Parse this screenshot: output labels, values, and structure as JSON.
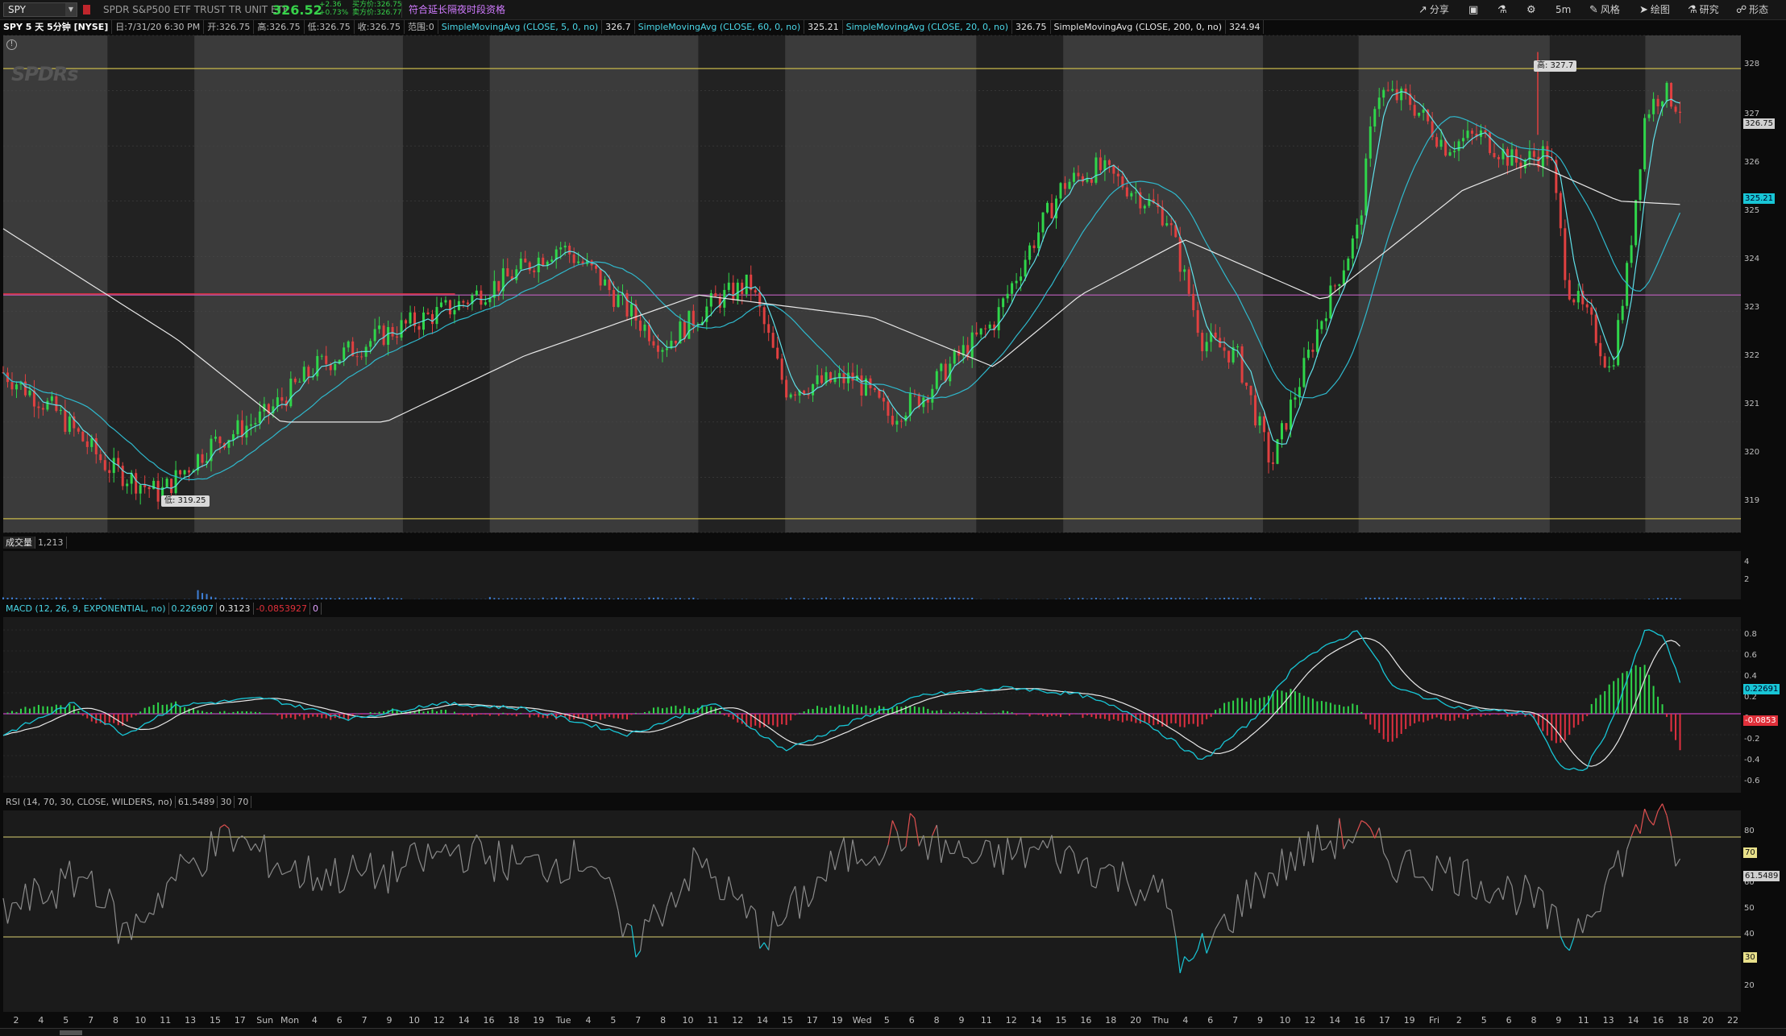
{
  "toolbar": {
    "symbol": "SPY",
    "company": "SPDR S&P500 ETF TRUST TR UNIT ETF",
    "last": "326.52",
    "net_change": "+2.36",
    "pct_change": "+0.73%",
    "bid": "买方价:326.75",
    "ask": "卖方价:326.77",
    "ext_hours": "符合延长隔夜时段资格",
    "items": {
      "share": "分享",
      "timeframe": "5m",
      "style": "风格",
      "drawings": "绘图",
      "studies": "研究",
      "pattern": "形态"
    }
  },
  "infobar": {
    "title": "SPY 5 天 5分钟 [NYSE]",
    "date": "日:7/31/20 6:30 PM",
    "open": "开:326.75",
    "high": "高:326.75",
    "low": "低:326.75",
    "close": "收:326.75",
    "range": "范围:0",
    "sma5": "SimpleMovingAvg (CLOSE, 5, 0, no)",
    "sma5_val": "326.7",
    "sma60": "SimpleMovingAvg (CLOSE, 60, 0, no)",
    "sma60_val": "325.21",
    "sma20": "SimpleMovingAvg (CLOSE, 20, 0, no)",
    "sma20_val": "326.75",
    "sma200": "SimpleMovingAvg (CLOSE, 200, 0, no)",
    "sma200_val": "324.94"
  },
  "price_pane": {
    "watermark": "SPDRs",
    "high_label": "高: 327.7",
    "low_label": "低: 319.25",
    "axis": [
      "328",
      "327",
      "326",
      "325",
      "324",
      "323",
      "322",
      "321",
      "320",
      "319"
    ],
    "tags": {
      "last": "326.75",
      "sma60": "325.21"
    }
  },
  "volume_pane": {
    "label": "成交量",
    "value": "1,213",
    "axis": [
      "4",
      "2"
    ]
  },
  "macd_pane": {
    "label": "MACD (12, 26, 9, EXPONENTIAL, no)",
    "value": "0.226907",
    "avg": "0.3123",
    "diff": "-0.0853927",
    "zero": "0",
    "axis": [
      "0.8",
      "0.6",
      "0.4",
      "0.2",
      "0",
      "-0.2",
      "-0.4",
      "-0.6"
    ],
    "tags": {
      "value": "0.22691",
      "diff": "-0.0853"
    }
  },
  "rsi_pane": {
    "label": "RSI (14, 70, 30, CLOSE, WILDERS, no)",
    "value": "61.5489",
    "over_sold": "30",
    "over_bought": "70",
    "axis": [
      "80",
      "60",
      "50",
      "40",
      "20"
    ],
    "tags": {
      "ob": "70",
      "value": "61.5489",
      "os": "30"
    }
  },
  "time_axis": [
    "2",
    "4",
    "5",
    "7",
    "8",
    "10",
    "11",
    "13",
    "15",
    "17",
    "Sun",
    "Mon",
    "4",
    "6",
    "7",
    "9",
    "10",
    "12",
    "14",
    "16",
    "18",
    "19",
    "Tue",
    "4",
    "5",
    "7",
    "8",
    "10",
    "11",
    "12",
    "14",
    "15",
    "17",
    "19",
    "Wed",
    "5",
    "6",
    "8",
    "9",
    "11",
    "12",
    "14",
    "15",
    "16",
    "18",
    "20",
    "Thu",
    "4",
    "6",
    "7",
    "9",
    "10",
    "12",
    "14",
    "16",
    "17",
    "19",
    "Fri",
    "2",
    "5",
    "6",
    "8",
    "9",
    "11",
    "13",
    "14",
    "16",
    "18",
    "20",
    "22"
  ],
  "chart_data": {
    "type": "candlestick",
    "symbol": "SPY",
    "interval": "5m",
    "days": 5,
    "price_range": [
      319,
      328
    ],
    "high": 327.7,
    "low": 319.25,
    "key_levels": [
      327.4,
      323.3,
      319.25
    ],
    "close_path": [
      [
        0,
        321.9
      ],
      [
        0.03,
        321.2
      ],
      [
        0.06,
        320.2
      ],
      [
        0.09,
        319.7
      ],
      [
        0.12,
        320.6
      ],
      [
        0.15,
        321.1
      ],
      [
        0.18,
        322.0
      ],
      [
        0.22,
        322.6
      ],
      [
        0.26,
        323.1
      ],
      [
        0.29,
        323.6
      ],
      [
        0.32,
        324.2
      ],
      [
        0.34,
        323.7
      ],
      [
        0.36,
        323.0
      ],
      [
        0.38,
        322.4
      ],
      [
        0.41,
        323.2
      ],
      [
        0.43,
        323.5
      ],
      [
        0.45,
        321.6
      ],
      [
        0.47,
        321.7
      ],
      [
        0.49,
        321.8
      ],
      [
        0.51,
        321.1
      ],
      [
        0.53,
        321.5
      ],
      [
        0.55,
        322.2
      ],
      [
        0.57,
        322.8
      ],
      [
        0.59,
        324.1
      ],
      [
        0.61,
        325.3
      ],
      [
        0.63,
        325.6
      ],
      [
        0.65,
        325.2
      ],
      [
        0.67,
        324.7
      ],
      [
        0.69,
        322.5
      ],
      [
        0.71,
        322.2
      ],
      [
        0.73,
        320.2
      ],
      [
        0.74,
        321.2
      ],
      [
        0.76,
        323.0
      ],
      [
        0.78,
        324.5
      ],
      [
        0.79,
        327.0
      ],
      [
        0.81,
        326.8
      ],
      [
        0.83,
        326.0
      ],
      [
        0.85,
        326.2
      ],
      [
        0.87,
        325.7
      ],
      [
        0.89,
        325.9
      ],
      [
        0.9,
        323.5
      ],
      [
        0.915,
        322.7
      ],
      [
        0.925,
        321.9
      ],
      [
        0.935,
        323.8
      ],
      [
        0.945,
        326.6
      ],
      [
        0.955,
        327.0
      ],
      [
        0.965,
        326.7
      ]
    ],
    "sma200_path": [
      [
        0,
        324.5
      ],
      [
        0.1,
        322.5
      ],
      [
        0.16,
        321.0
      ],
      [
        0.22,
        321.0
      ],
      [
        0.3,
        322.2
      ],
      [
        0.4,
        323.3
      ],
      [
        0.5,
        322.9
      ],
      [
        0.57,
        322.0
      ],
      [
        0.62,
        323.3
      ],
      [
        0.68,
        324.3
      ],
      [
        0.76,
        323.2
      ],
      [
        0.84,
        325.2
      ],
      [
        0.88,
        325.7
      ],
      [
        0.93,
        325.0
      ],
      [
        0.965,
        324.94
      ]
    ],
    "volume_peaks": [
      0.11,
      0.27,
      0.43,
      0.59,
      0.75,
      0.915
    ],
    "macd_path": [
      [
        0,
        -0.2
      ],
      [
        0.04,
        0.1
      ],
      [
        0.07,
        -0.2
      ],
      [
        0.1,
        0.08
      ],
      [
        0.15,
        0.15
      ],
      [
        0.2,
        -0.05
      ],
      [
        0.25,
        0.1
      ],
      [
        0.3,
        0.05
      ],
      [
        0.36,
        -0.2
      ],
      [
        0.41,
        0.1
      ],
      [
        0.45,
        -0.35
      ],
      [
        0.5,
        0.0
      ],
      [
        0.53,
        0.18
      ],
      [
        0.58,
        0.25
      ],
      [
        0.62,
        0.18
      ],
      [
        0.65,
        0.0
      ],
      [
        0.69,
        -0.45
      ],
      [
        0.72,
        -0.05
      ],
      [
        0.745,
        0.5
      ],
      [
        0.78,
        0.8
      ],
      [
        0.8,
        0.25
      ],
      [
        0.84,
        0.05
      ],
      [
        0.88,
        0.0
      ],
      [
        0.895,
        -0.5
      ],
      [
        0.91,
        -0.55
      ],
      [
        0.925,
        -0.1
      ],
      [
        0.945,
        0.8
      ],
      [
        0.955,
        0.75
      ],
      [
        0.965,
        0.3
      ]
    ],
    "rsi_path": [
      [
        0,
        40
      ],
      [
        0.05,
        55
      ],
      [
        0.07,
        30
      ],
      [
        0.1,
        55
      ],
      [
        0.13,
        70
      ],
      [
        0.17,
        55
      ],
      [
        0.22,
        55
      ],
      [
        0.26,
        65
      ],
      [
        0.3,
        58
      ],
      [
        0.34,
        62
      ],
      [
        0.36,
        25
      ],
      [
        0.4,
        60
      ],
      [
        0.44,
        30
      ],
      [
        0.48,
        60
      ],
      [
        0.52,
        72
      ],
      [
        0.56,
        60
      ],
      [
        0.6,
        65
      ],
      [
        0.64,
        55
      ],
      [
        0.67,
        45
      ],
      [
        0.68,
        15
      ],
      [
        0.72,
        50
      ],
      [
        0.75,
        65
      ],
      [
        0.78,
        72
      ],
      [
        0.8,
        60
      ],
      [
        0.84,
        55
      ],
      [
        0.88,
        45
      ],
      [
        0.9,
        28
      ],
      [
        0.92,
        50
      ],
      [
        0.94,
        70
      ],
      [
        0.945,
        82
      ],
      [
        0.955,
        75
      ],
      [
        0.965,
        60
      ]
    ]
  }
}
